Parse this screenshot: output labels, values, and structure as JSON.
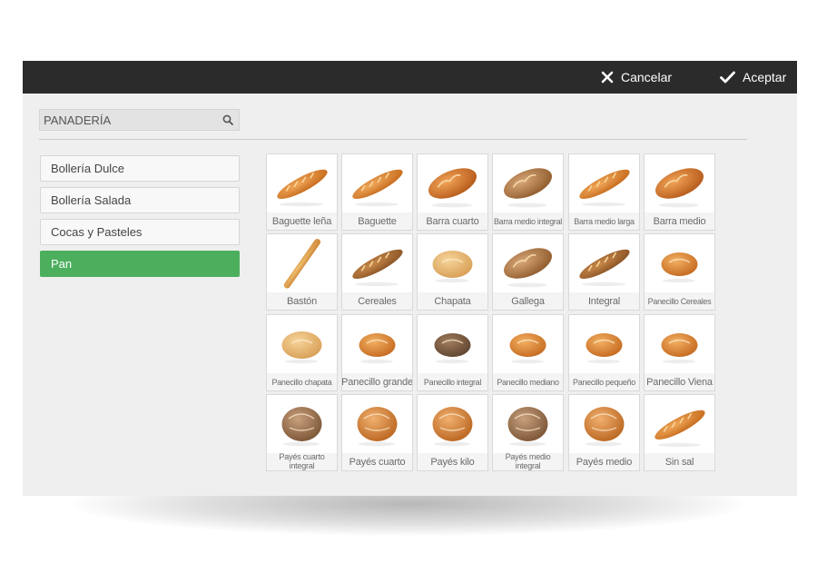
{
  "toolbar": {
    "cancel_label": "Cancelar",
    "accept_label": "Aceptar",
    "icons": [
      "close-icon",
      "check-icon"
    ]
  },
  "search": {
    "value": "PANADERÍA",
    "icon": "search-icon"
  },
  "categories": [
    {
      "label": "Bollería Dulce",
      "active": false
    },
    {
      "label": "Bollería Salada",
      "active": false
    },
    {
      "label": "Cocas y Pasteles",
      "active": false
    },
    {
      "label": "Pan",
      "active": true
    }
  ],
  "colors": {
    "accent": "#4caf5d",
    "topbar": "#2b2b2b",
    "background": "#efefef"
  },
  "products": [
    {
      "label": "Baguette leña",
      "icon": "bread-baguette-icon"
    },
    {
      "label": "Baguette",
      "icon": "bread-baguette-icon"
    },
    {
      "label": "Barra cuarto",
      "icon": "bread-loaf-icon"
    },
    {
      "label": "Barra medio integral",
      "icon": "bread-loaf-icon"
    },
    {
      "label": "Barra medio larga",
      "icon": "bread-baguette-icon"
    },
    {
      "label": "Barra medio",
      "icon": "bread-loaf-icon"
    },
    {
      "label": "Bastón",
      "icon": "bread-stick-icon"
    },
    {
      "label": "Cereales",
      "icon": "bread-baguette-icon"
    },
    {
      "label": "Chapata",
      "icon": "bread-roll-icon"
    },
    {
      "label": "Gallega",
      "icon": "bread-loaf-icon"
    },
    {
      "label": "Integral",
      "icon": "bread-baguette-icon"
    },
    {
      "label": "Panecillo Cereales",
      "icon": "bread-roll-icon"
    },
    {
      "label": "Panecillo chapata",
      "icon": "bread-roll-icon"
    },
    {
      "label": "Panecillo grande",
      "icon": "bread-roll-icon"
    },
    {
      "label": "Panecillo integral",
      "icon": "bread-roll-icon"
    },
    {
      "label": "Panecillo mediano",
      "icon": "bread-roll-icon"
    },
    {
      "label": "Panecillo pequeño",
      "icon": "bread-roll-icon"
    },
    {
      "label": "Panecillo Viena",
      "icon": "bread-roll-icon"
    },
    {
      "label": "Payés cuarto integral",
      "icon": "bread-round-icon"
    },
    {
      "label": "Payés cuarto",
      "icon": "bread-round-icon"
    },
    {
      "label": "Payés kilo",
      "icon": "bread-round-icon"
    },
    {
      "label": "Payés medio integral",
      "icon": "bread-round-icon"
    },
    {
      "label": "Payés medio",
      "icon": "bread-round-icon"
    },
    {
      "label": "Sin sal",
      "icon": "bread-baguette-icon"
    }
  ]
}
